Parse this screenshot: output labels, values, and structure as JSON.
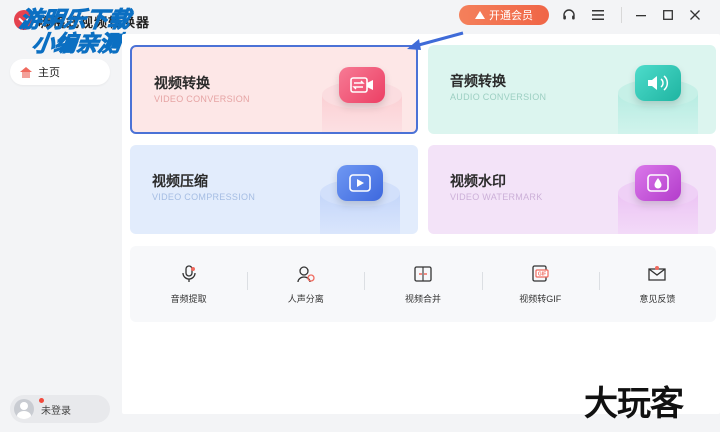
{
  "app": {
    "title": "嗨格式视频转换器"
  },
  "watermark_top": {
    "line1": "游明乐下载",
    "line2": "小编亲测"
  },
  "watermark_bottom": "大玩客",
  "header": {
    "vip_label": "开通会员",
    "icons": [
      "headset-icon",
      "menu-icon",
      "minimize-icon",
      "maximize-icon",
      "close-icon"
    ]
  },
  "sidebar": {
    "home_label": "主页",
    "login_label": "未登录"
  },
  "cards": [
    {
      "title": "视频转换",
      "subtitle": "VIDEO CONVERSION",
      "color": "#f05a7e",
      "icon": "convert-video-icon"
    },
    {
      "title": "音频转换",
      "subtitle": "AUDIO CONVERSION",
      "color": "#2cc7b3",
      "icon": "convert-audio-icon"
    },
    {
      "title": "视频压缩",
      "subtitle": "VIDEO COMPRESSION",
      "color": "#4f7de8",
      "icon": "compress-video-icon"
    },
    {
      "title": "视频水印",
      "subtitle": "VIDEO WATERMARK",
      "color": "#c650d8",
      "icon": "watermark-icon"
    }
  ],
  "tools": [
    {
      "label": "音频提取",
      "icon": "microphone-icon"
    },
    {
      "label": "人声分离",
      "icon": "voice-separation-icon"
    },
    {
      "label": "视频合并",
      "icon": "video-merge-icon"
    },
    {
      "label": "视频转GIF",
      "icon": "gif-icon"
    },
    {
      "label": "意见反馈",
      "icon": "feedback-icon"
    }
  ]
}
